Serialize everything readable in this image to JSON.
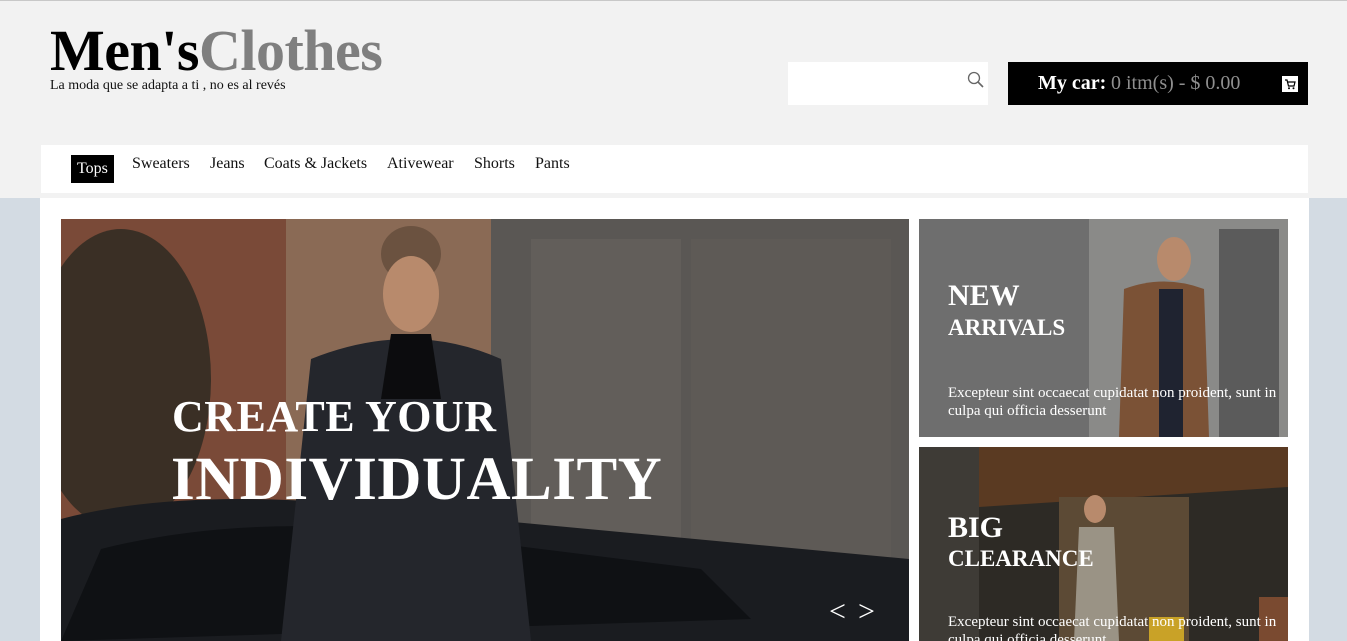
{
  "header": {
    "logo_part1": "Men's",
    "logo_part2": "Clothes",
    "tagline": "La moda que se adapta a ti , no es al revés",
    "search": {
      "placeholder": "",
      "icon": "search-icon"
    },
    "cart": {
      "label": "My car:",
      "info": "0 itm(s) - $ 0.00",
      "icon": "cart-icon"
    }
  },
  "nav": {
    "items": [
      {
        "label": "Tops",
        "active": true
      },
      {
        "label": "Sweaters"
      },
      {
        "label": "Jeans"
      },
      {
        "label": "Coats & Jackets"
      },
      {
        "label": "Ativewear"
      },
      {
        "label": "Shorts"
      },
      {
        "label": "Pants"
      }
    ]
  },
  "hero": {
    "line1": "CREATE YOUR",
    "line2": "INDIVIDUALITY",
    "prev": "<",
    "next": ">"
  },
  "promos": [
    {
      "title1": "NEW",
      "title2": "ARRIVALS",
      "text": "Excepteur sint occaecat cupidatat non proident, sunt in culpa qui officia desserunt"
    },
    {
      "title1": "BIG",
      "title2": "CLEARANCE",
      "text": "Excepteur sint occaecat cupidatat non proident, sunt in culpa qui officia desserunt"
    }
  ],
  "colors": {
    "header_bg": "#f2f2f2",
    "page_bg": "#d3dbe3",
    "accent": "#000000",
    "logo_gray": "#7f7f7f"
  }
}
